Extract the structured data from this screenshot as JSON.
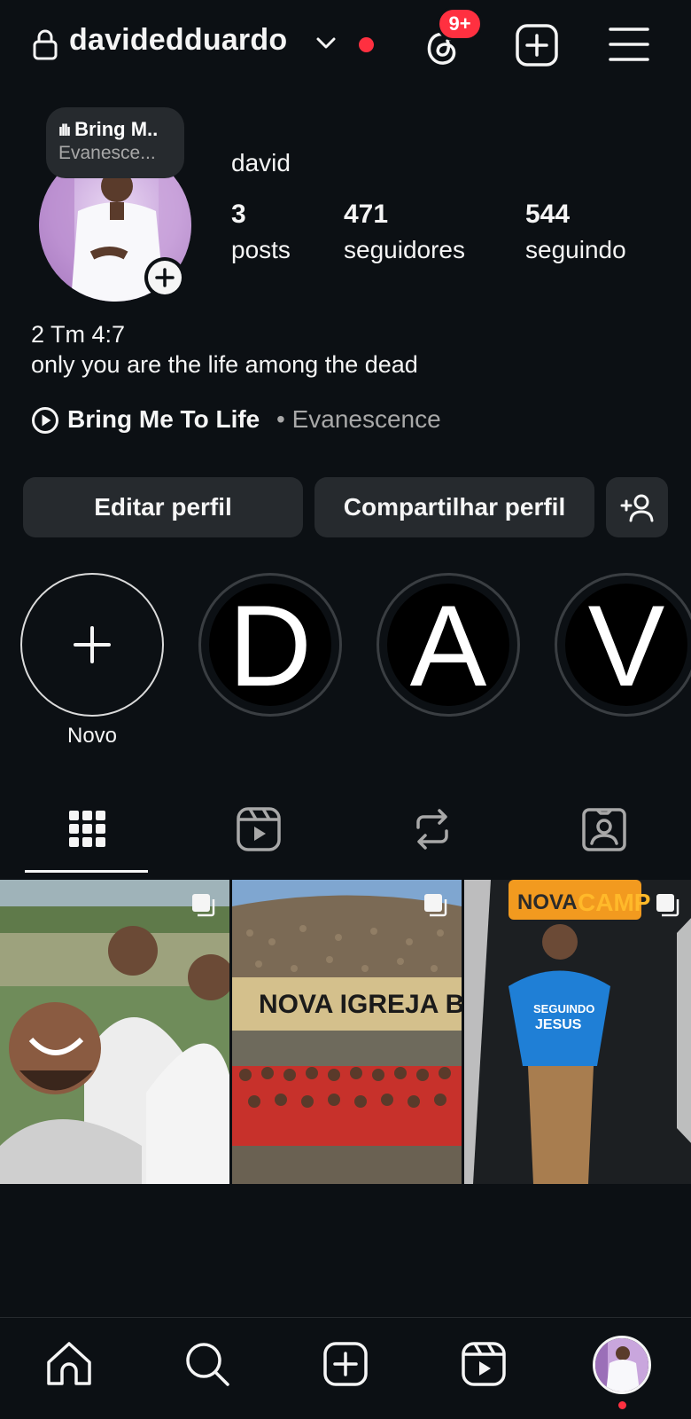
{
  "header": {
    "username": "davidedduardo",
    "notifications_badge": "9+",
    "icons": [
      "lock-icon",
      "chevron-down-icon",
      "threads-icon",
      "add-post-icon",
      "menu-icon"
    ]
  },
  "note": {
    "title": "Bring M..",
    "subtitle": "Evanesce..."
  },
  "profile": {
    "display_name": "david",
    "stats": [
      {
        "value": "3",
        "label": "posts"
      },
      {
        "value": "471",
        "label": "seguidores"
      },
      {
        "value": "544",
        "label": "seguindo"
      }
    ],
    "bio_line1": "2 Tm 4:7",
    "bio_line2": "only you are the life among the dead",
    "music": {
      "title": "Bring Me To Life",
      "separator": "•",
      "artist": "Evanescence"
    }
  },
  "buttons": {
    "edit": "Editar perfil",
    "share": "Compartilhar perfil"
  },
  "highlights": [
    {
      "label": "Novo",
      "letter": "+"
    },
    {
      "label": "",
      "letter": "D"
    },
    {
      "label": "",
      "letter": "A"
    },
    {
      "label": "",
      "letter": "V"
    }
  ],
  "tabs": [
    "grid-icon",
    "reels-icon",
    "reposts-icon",
    "tagged-icon"
  ],
  "colors": {
    "background": "#0c1014",
    "surface": "#262a2e",
    "accent_red": "#ff3040",
    "text_secondary": "#a8a8a8"
  }
}
